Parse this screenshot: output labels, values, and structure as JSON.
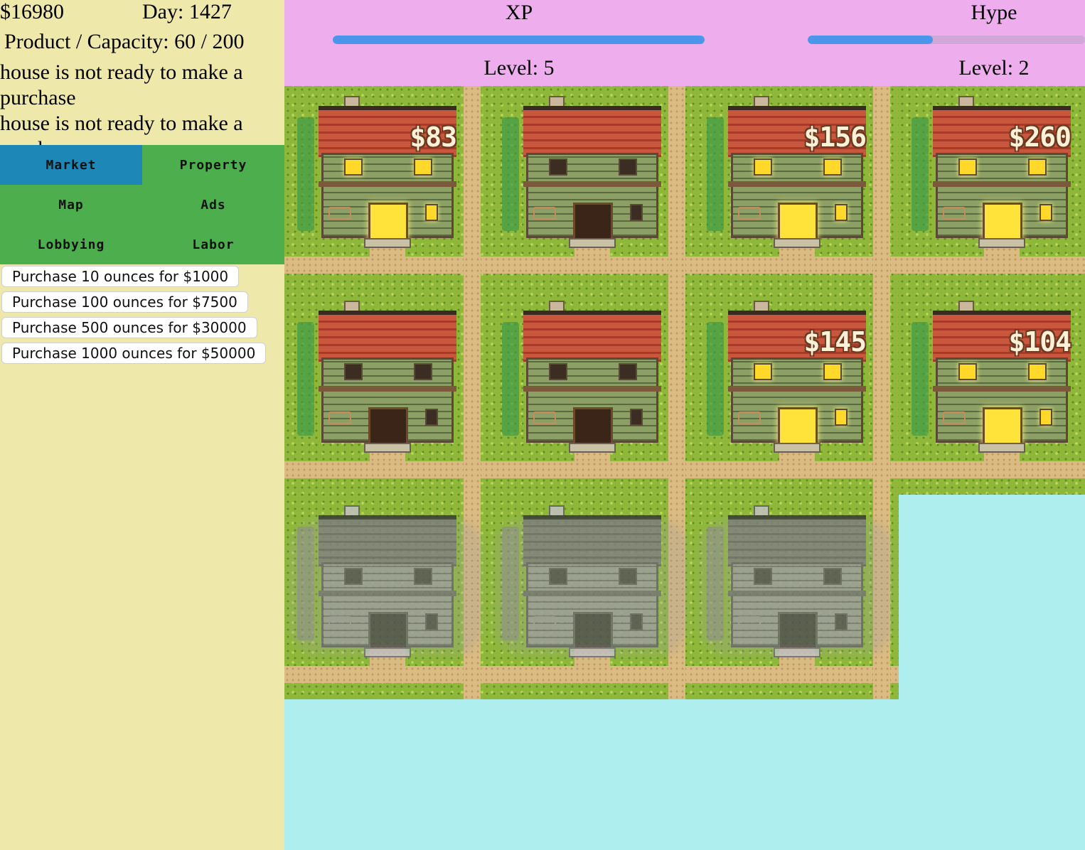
{
  "stats": {
    "money": "$16980",
    "day": "Day: 1427",
    "capacity": "Product / Capacity: 60 / 200"
  },
  "log": [
    "house is not ready to make a purchase",
    "house is not ready to make a purchase"
  ],
  "menu": {
    "tabs": [
      {
        "label": "Market",
        "active": true
      },
      {
        "label": "Property",
        "active": false
      },
      {
        "label": "Map",
        "active": false
      },
      {
        "label": "Ads",
        "active": false
      },
      {
        "label": "Lobbying",
        "active": false
      },
      {
        "label": "Labor",
        "active": false
      }
    ]
  },
  "market": {
    "buttons": [
      {
        "label": "Purchase 10 ounces for $1000"
      },
      {
        "label": "Purchase 100 ounces for $7500"
      },
      {
        "label": "Purchase 500 ounces for $30000"
      },
      {
        "label": "Purchase 1000 ounces for $50000"
      }
    ]
  },
  "xp": {
    "title": "XP",
    "level": "Level: 5",
    "progress": 1.0
  },
  "hype": {
    "title": "Hype",
    "level": "Level: 2",
    "progress": 0.45
  },
  "houses": [
    {
      "price": "$83",
      "lit": true,
      "gray": false
    },
    {
      "price": "",
      "lit": false,
      "gray": false
    },
    {
      "price": "$156",
      "lit": true,
      "gray": false
    },
    {
      "price": "$260",
      "lit": true,
      "gray": false
    },
    {
      "price": "",
      "lit": false,
      "gray": false
    },
    {
      "price": "",
      "lit": false,
      "gray": false
    },
    {
      "price": "$145",
      "lit": true,
      "gray": false
    },
    {
      "price": "$104",
      "lit": true,
      "gray": false
    },
    {
      "price": "",
      "lit": false,
      "gray": true
    },
    {
      "price": "",
      "lit": false,
      "gray": true
    },
    {
      "price": "",
      "lit": false,
      "gray": true
    }
  ],
  "colors": {
    "sidebar": "#eee8aa",
    "menu": "#4cae4c",
    "active_tab": "#1d87b8",
    "topbar": "#eeaeee",
    "progress": "#4b95ea",
    "background": "#aeeeee"
  }
}
